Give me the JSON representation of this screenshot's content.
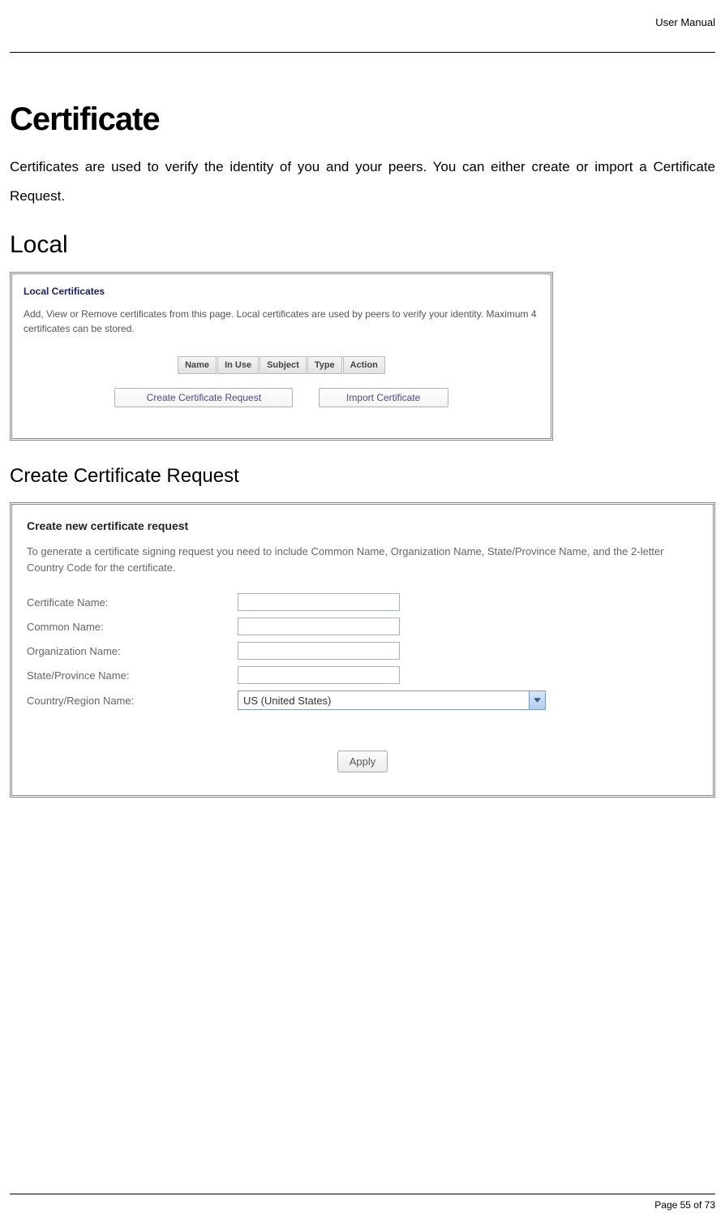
{
  "header": {
    "right": "User Manual"
  },
  "title": "Certificate",
  "intro": "Certificates are used to verify the identity of you and your peers. You can either create or import a Certificate Request.",
  "section_local": "Local",
  "panel1": {
    "title": "Local Certificates",
    "desc": "Add, View or Remove certificates from this page. Local certificates are used by peers to verify your identity. Maximum 4 certificates can be stored.",
    "cols": [
      "Name",
      "In Use",
      "Subject",
      "Type",
      "Action"
    ],
    "btn_create": "Create Certificate Request",
    "btn_import": "Import Certificate"
  },
  "section_create": "Create Certificate Request",
  "panel2": {
    "title": "Create new certificate request",
    "desc": "To generate a certificate signing request you need to include Common Name, Organization Name, State/Province Name, and the 2-letter Country Code for the certificate.",
    "labels": {
      "cert": "Certificate Name:",
      "common": "Common Name:",
      "org": "Organization Name:",
      "state": "State/Province Name:",
      "country": "Country/Region Name:"
    },
    "country_value": "US (United States)",
    "apply": "Apply"
  },
  "footer": {
    "page": "Page 55 of 73"
  }
}
